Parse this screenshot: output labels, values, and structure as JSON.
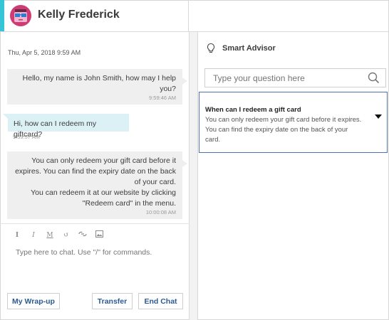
{
  "header": {
    "contact_name": "Kelly Frederick"
  },
  "chat": {
    "date": "Thu, Apr 5, 2018 9:59 AM",
    "messages": [
      {
        "role": "agent",
        "lines": [
          "Hello, my name is John Smith, how may I help",
          "you?"
        ],
        "time": "9:59:46 AM"
      },
      {
        "role": "customer",
        "lines": [
          "Hi, how can I redeem my giftcard?"
        ],
        "time": "9:59:57 AM"
      },
      {
        "role": "agent",
        "lines": [
          "You can only redeem your gift card before it",
          "expires. You can find the expiry date on the back",
          "of your card.",
          "You can redeem it at our website by clicking",
          "\"Redeem card\" in the menu."
        ],
        "time": "10:00:08 AM"
      }
    ]
  },
  "composer": {
    "placeholder": "Type here to chat. Use \"/\" for commands.",
    "tools": [
      "bold-icon",
      "italic-icon",
      "underline-icon",
      "undo-icon",
      "link-icon",
      "image-icon"
    ]
  },
  "buttons": {
    "wrapup": "My Wrap-up",
    "transfer": "Transfer",
    "end_chat": "End Chat"
  },
  "advisor": {
    "title": "Smart Advisor",
    "search_placeholder": "Type your question here",
    "answer": {
      "question": "When can I redeem a gift card",
      "text": "You can only redeem your gift card before it expires. You can find the expiry date on the back of your card."
    }
  },
  "colors": {
    "accent": "#36c5d6",
    "avatar": "#d13b73",
    "button_text": "#2b5a93",
    "card_border": "#4f6fb0",
    "customer_bubble": "#dbf1f6",
    "agent_bubble": "#efefef"
  }
}
